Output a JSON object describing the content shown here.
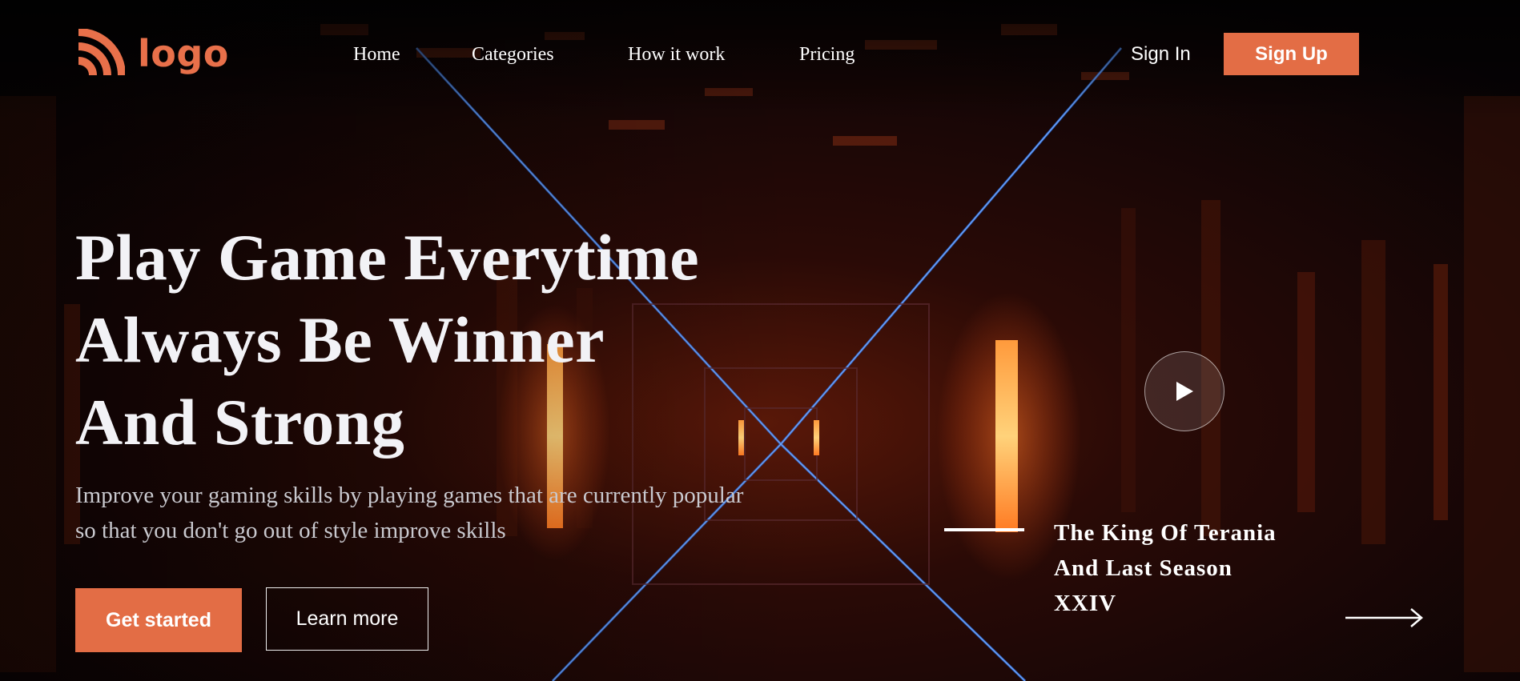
{
  "brand": {
    "name": "logo",
    "color": "#E8704A"
  },
  "nav": {
    "items": [
      {
        "label": "Home"
      },
      {
        "label": "Categories"
      },
      {
        "label": "How it work"
      },
      {
        "label": "Pricing"
      }
    ]
  },
  "auth": {
    "sign_in": "Sign In",
    "sign_up": "Sign Up"
  },
  "hero": {
    "headline_lines": [
      "Play Game Everytime",
      "Always Be Winner",
      "And Strong"
    ],
    "subtext": "Improve your gaming skills by playing games that are currently popular so that you don't go out of style improve skills",
    "primary_cta": "Get started",
    "secondary_cta": "Learn more"
  },
  "feature": {
    "title_lines": [
      "The King Of Terania",
      "And Last Season",
      "XXIV"
    ],
    "play_icon": "play-icon",
    "next_icon": "arrow-right-icon"
  },
  "colors": {
    "accent": "#E36D45",
    "text": "#FFFFFF"
  }
}
